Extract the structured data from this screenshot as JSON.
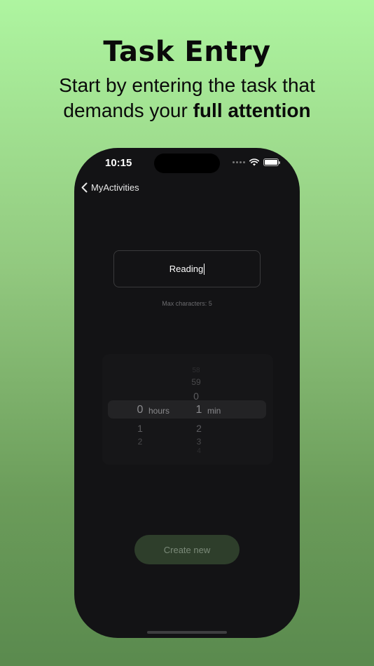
{
  "headline": {
    "title": "Task Entry",
    "subtitle_line1": "Start by entering the task that",
    "subtitle_line2_prefix": "demands your ",
    "subtitle_line2_bold": "full attention"
  },
  "status_bar": {
    "time": "10:15"
  },
  "nav": {
    "back_label": "MyActivities"
  },
  "task": {
    "value": "Reading",
    "hint": "Max characters: 5"
  },
  "picker": {
    "hours": {
      "above": "",
      "selected": "0",
      "below": [
        "1",
        "2"
      ],
      "unit": "hours"
    },
    "minutes": {
      "above": [
        "58",
        "59",
        "0"
      ],
      "selected": "1",
      "below": [
        "2",
        "3",
        "4"
      ],
      "unit": "min"
    }
  },
  "actions": {
    "create_label": "Create new"
  }
}
